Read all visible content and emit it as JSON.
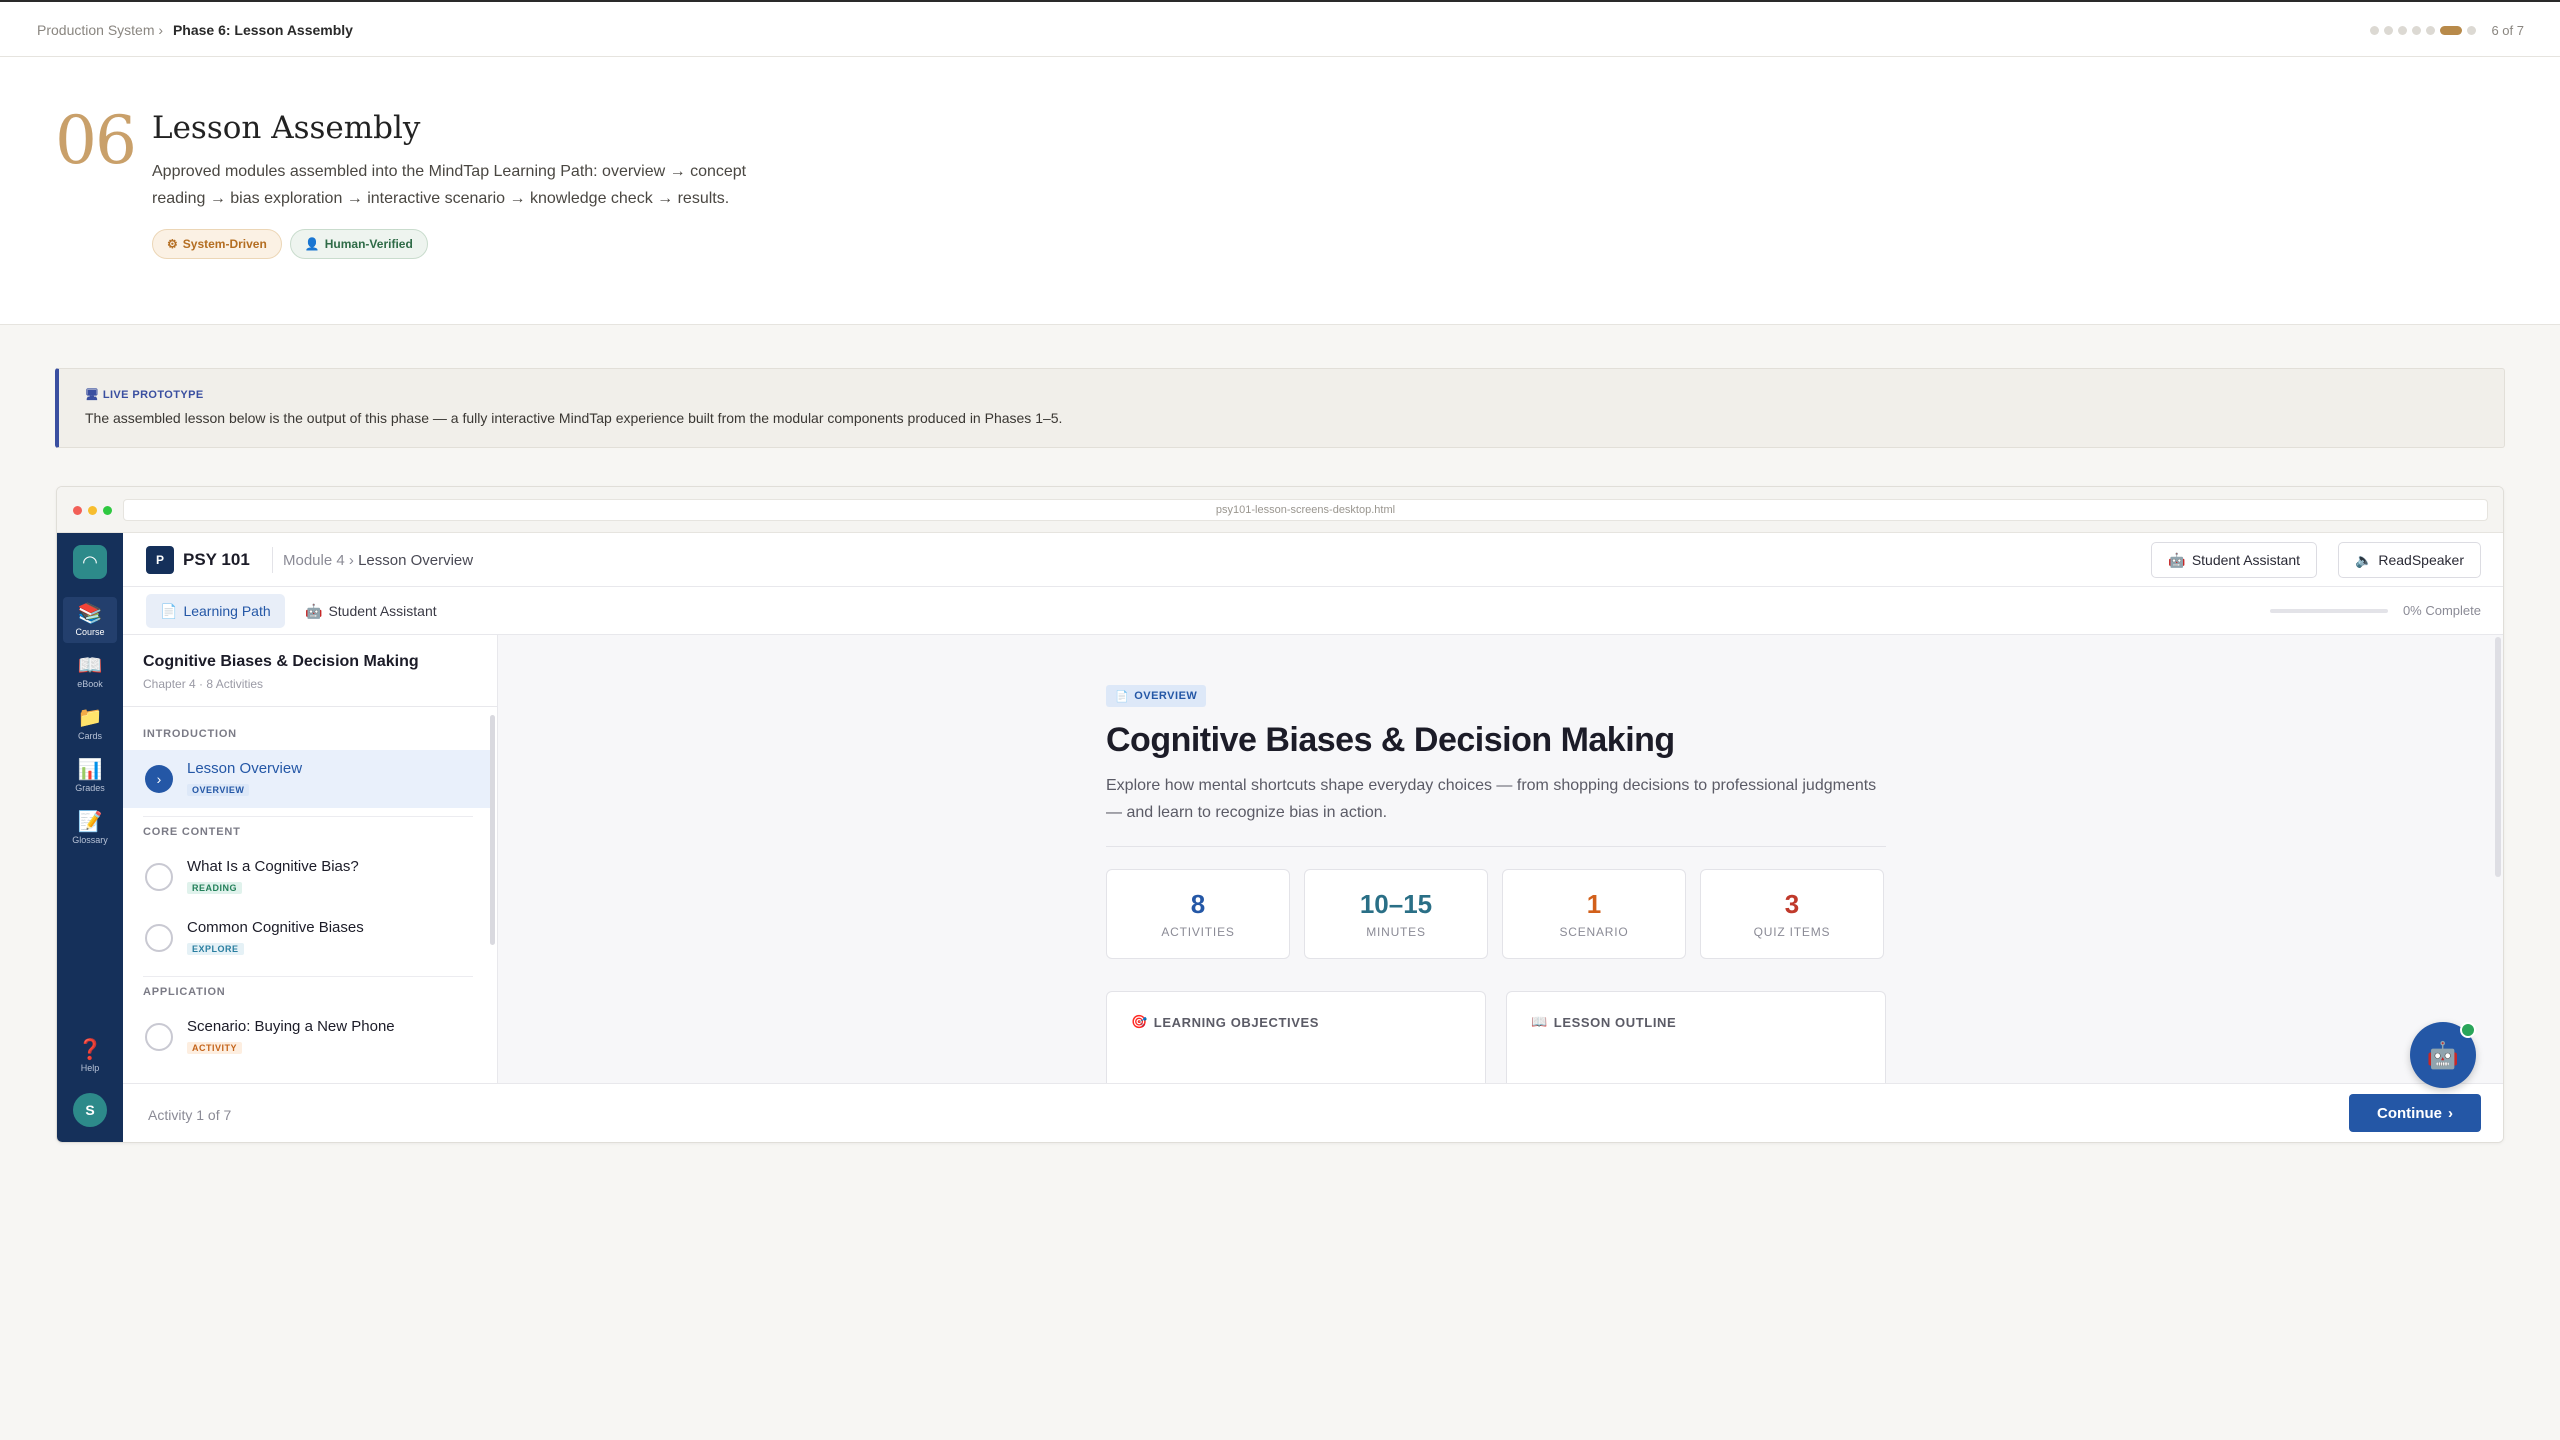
{
  "topbar": {
    "crumb_root": "Production System",
    "crumb_sep": "›",
    "crumb_current": "Phase 6: Lesson Assembly",
    "phase_count": "6 of 7",
    "phases_total": 7,
    "phase_current": 6
  },
  "hero": {
    "number": "06",
    "title": "Lesson Assembly",
    "description": "Approved modules assembled into the MindTap Learning Path: overview → concept reading → bias exploration → interactive scenario → knowledge check → results.",
    "badges": [
      {
        "icon": "⚙",
        "label": "System-Driven"
      },
      {
        "icon": "👤",
        "label": "Human-Verified"
      }
    ]
  },
  "note": {
    "icon": "🖥",
    "label": "LIVE PROTOTYPE",
    "text": "The assembled lesson below is the output of this phase — a fully interactive MindTap experience built from the modular components produced in Phases 1–5."
  },
  "browser": {
    "url": "psy101-lesson-screens-desktop.html",
    "traffic_colors": [
      "#f25f57",
      "#f7bd2e",
      "#2ec840"
    ]
  },
  "rail": {
    "logo_icon": "◠",
    "items": [
      {
        "icon": "📚",
        "label": "Course"
      },
      {
        "icon": "📖",
        "label": "eBook"
      },
      {
        "icon": "📁",
        "label": "Cards"
      },
      {
        "icon": "📊",
        "label": "Grades"
      },
      {
        "icon": "📝",
        "label": "Glossary"
      }
    ],
    "help": {
      "icon": "❓",
      "label": "Help"
    },
    "avatar": "S"
  },
  "app": {
    "course_logo": "P",
    "course_name": "PSY 101",
    "crumb_module": "Module 4",
    "crumb_sep": "›",
    "crumb_current": "Lesson Overview",
    "btn_assistant": {
      "icon": "🤖",
      "label": "Student Assistant"
    },
    "btn_readspeaker": {
      "icon": "🔈",
      "label": "ReadSpeaker"
    },
    "tabs": [
      {
        "icon": "📄",
        "label": "Learning Path"
      },
      {
        "icon": "🤖",
        "label": "Student Assistant"
      }
    ],
    "progress_fraction": 0,
    "progress_label": "0% Complete"
  },
  "lesson_sidebar": {
    "title": "Cognitive Biases & Decision Making",
    "subtitle": "Chapter 4 · 8 Activities",
    "sections": [
      {
        "label": "INTRODUCTION"
      },
      {
        "label": "CORE CONTENT"
      },
      {
        "label": "APPLICATION"
      }
    ],
    "activities": [
      {
        "name": "Lesson Overview",
        "tag": "OVERVIEW",
        "active_icon": "›"
      },
      {
        "name": "What Is a Cognitive Bias?",
        "tag": "READING"
      },
      {
        "name": "Common Cognitive Biases",
        "tag": "EXPLORE"
      },
      {
        "name": "Scenario: Buying a New Phone",
        "tag": "ACTIVITY"
      }
    ]
  },
  "overview": {
    "pill_icon": "📄",
    "pill_label": "OVERVIEW",
    "title": "Cognitive Biases & Decision Making",
    "description": "Explore how mental shortcuts shape everyday choices — from shopping decisions to professional judgments — and learn to recognize bias in action.",
    "stats": [
      {
        "value": "8",
        "label": "ACTIVITIES",
        "color": "#2457a6"
      },
      {
        "value": "10–15",
        "label": "MINUTES",
        "color": "#2a6f86"
      },
      {
        "value": "1",
        "label": "SCENARIO",
        "color": "#d2601a"
      },
      {
        "value": "3",
        "label": "QUIZ ITEMS",
        "color": "#c0392b"
      }
    ],
    "cards": [
      {
        "icon": "🎯",
        "title": "LEARNING OBJECTIVES"
      },
      {
        "icon": "📖",
        "title": "LESSON OUTLINE"
      }
    ]
  },
  "footer": {
    "activity_count": "Activity 1 of 7",
    "continue_label": "Continue",
    "continue_icon": "›",
    "bot_icon": "🤖"
  }
}
